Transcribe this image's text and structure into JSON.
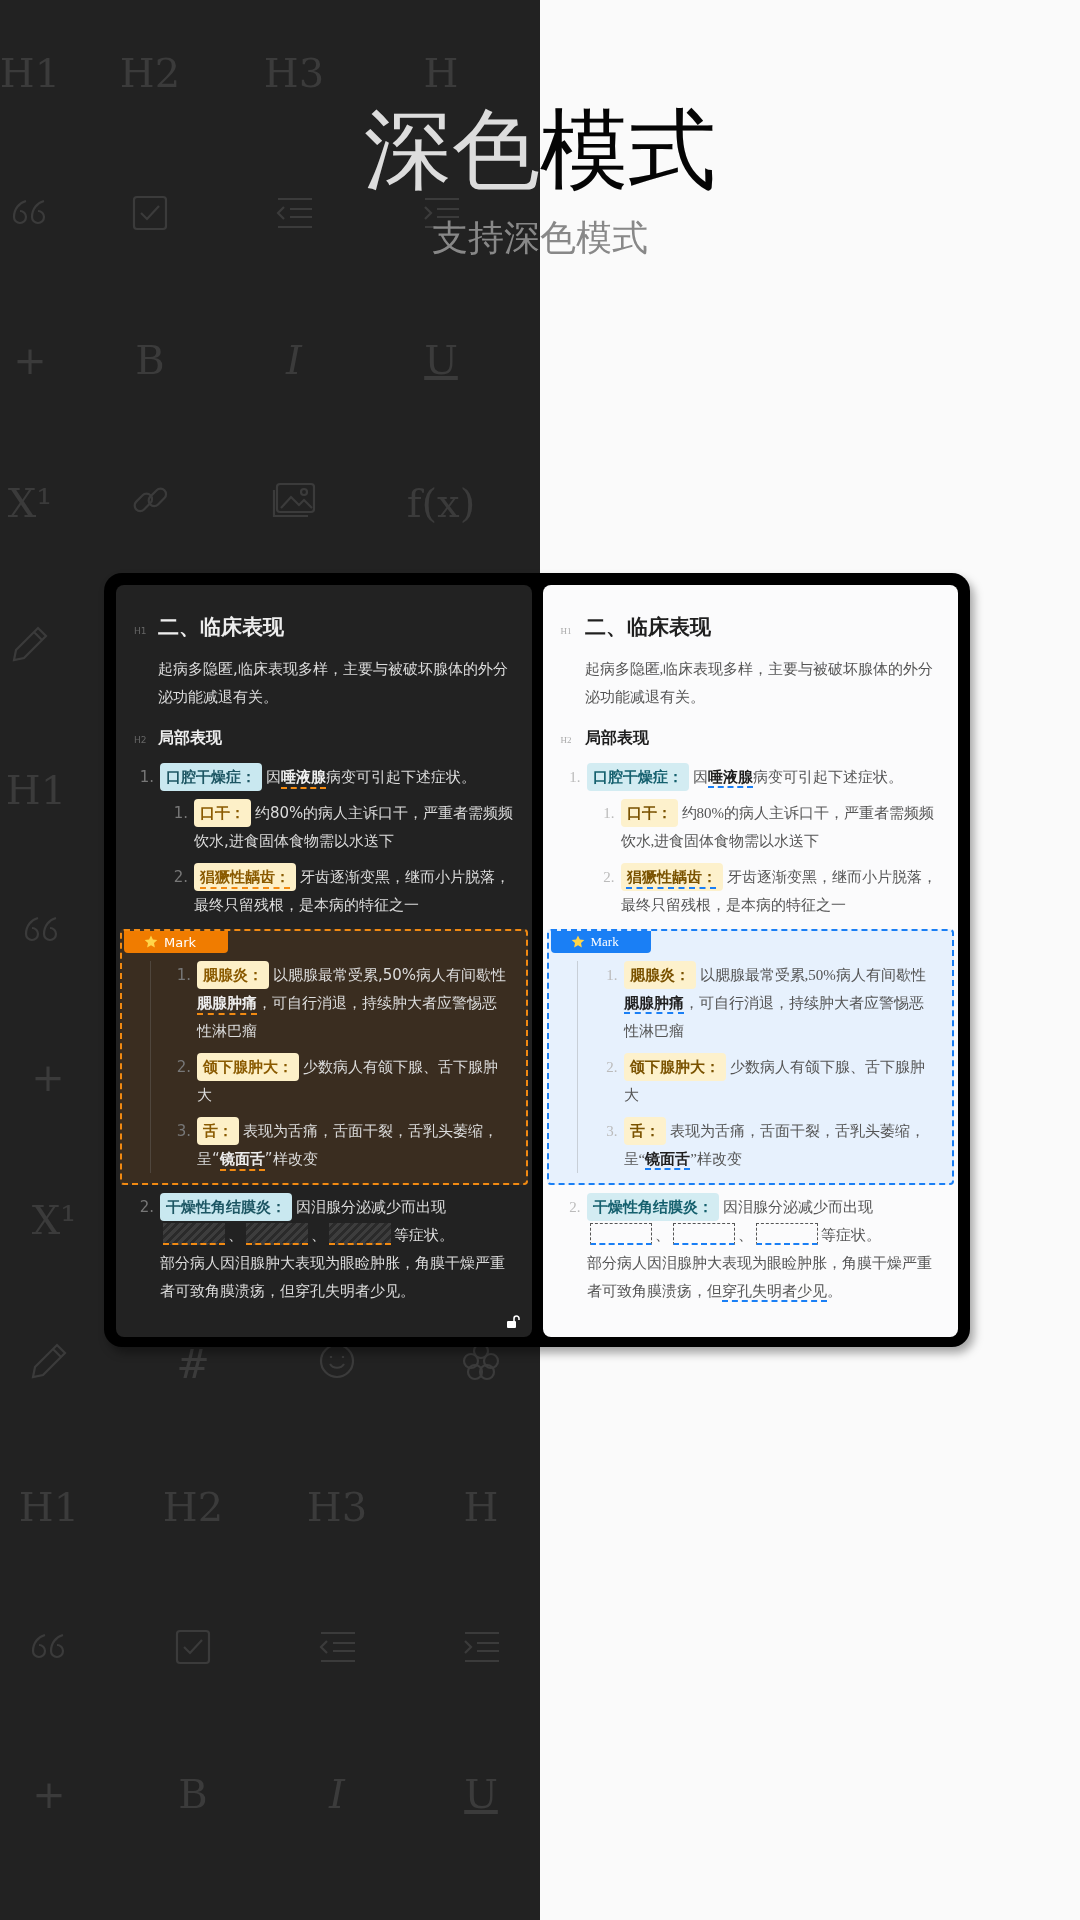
{
  "background_rows": [
    {
      "items": [
        {
          "kind": "text",
          "text": "H1"
        },
        {
          "kind": "text",
          "text": "H2"
        },
        {
          "kind": "text",
          "text": "H3"
        },
        {
          "kind": "text",
          "text": "H"
        }
      ]
    },
    {
      "items": [
        {
          "kind": "quote"
        },
        {
          "kind": "checkbox"
        },
        {
          "kind": "outdent"
        },
        {
          "kind": "indent"
        }
      ]
    },
    {
      "items": [
        {
          "kind": "text",
          "text": "+"
        },
        {
          "kind": "text",
          "text": "B"
        },
        {
          "kind": "text",
          "text": "I",
          "italic": true
        },
        {
          "kind": "text",
          "text": "U",
          "underlined": true
        }
      ]
    },
    {
      "items": [
        {
          "kind": "text",
          "text": "X¹"
        },
        {
          "kind": "link"
        },
        {
          "kind": "image"
        },
        {
          "kind": "text",
          "text": "f(x)"
        }
      ]
    },
    {
      "items": [
        {
          "kind": "pencil"
        }
      ]
    },
    {
      "items": [
        {
          "kind": "text",
          "text": "H1"
        }
      ]
    },
    {
      "items": [
        {
          "kind": "quote"
        }
      ]
    },
    {
      "items": [
        {
          "kind": "text",
          "text": "+"
        }
      ]
    },
    {
      "items": [
        {
          "kind": "text",
          "text": "X¹"
        }
      ]
    },
    {
      "items": [
        {
          "kind": "pencil"
        },
        {
          "kind": "text",
          "text": "#"
        },
        {
          "kind": "smiley"
        },
        {
          "kind": "flower"
        }
      ]
    },
    {
      "items": [
        {
          "kind": "text",
          "text": "H1"
        },
        {
          "kind": "text",
          "text": "H2"
        },
        {
          "kind": "text",
          "text": "H3"
        },
        {
          "kind": "text",
          "text": "H"
        }
      ]
    },
    {
      "items": [
        {
          "kind": "quote"
        },
        {
          "kind": "checkbox"
        },
        {
          "kind": "outdent"
        },
        {
          "kind": "indent"
        }
      ]
    },
    {
      "items": [
        {
          "kind": "text",
          "text": "+"
        },
        {
          "kind": "text",
          "text": "B"
        },
        {
          "kind": "text",
          "text": "I",
          "italic": true
        },
        {
          "kind": "text",
          "text": "U",
          "underlined": true
        }
      ]
    }
  ],
  "title": "深色模式",
  "subtitle": "支持深色模式",
  "panes": [
    {
      "kind": "dark",
      "h1": {
        "marker": "H1",
        "text": "二、临床表现"
      },
      "intro": "起病多隐匿,临床表现多样，主要与被破坏腺体的外分泌功能减退有关。",
      "h2": {
        "marker": "H2",
        "text": "局部表现"
      },
      "blocks": [
        {
          "kind": "item",
          "number": "1.",
          "tag": {
            "text": "口腔干燥症：",
            "color": "#c9e8f0",
            "underlined": false
          },
          "body": [
            {
              "kind": "text",
              "text": "因"
            },
            {
              "kind": "text",
              "text": "唾液腺",
              "bold": true,
              "underlined": true
            },
            {
              "kind": "text",
              "text": "病变可引起下述症状。"
            }
          ],
          "children": [
            {
              "number": "1.",
              "tag": {
                "text": "口干：",
                "color": "#fdf0c8",
                "underlined": false
              },
              "body": [
                {
                  "kind": "text",
                  "text": "约80%的病人主诉口干，严重者需频频饮水,进食固体食物需以水送下"
                }
              ]
            },
            {
              "number": "2.",
              "tag": {
                "text": "猖獗性龋齿：",
                "color": "#fdf0c8",
                "underlined": true
              },
              "body": [
                {
                  "kind": "text",
                  "text": "牙齿逐渐变黑，继而小片脱落，最终只留残根，是本病的特征之一"
                }
              ]
            }
          ]
        },
        {
          "kind": "mark",
          "label": "Mark",
          "children": [
            {
              "number": "1.",
              "tag": {
                "text": "腮腺炎：",
                "color": "#fdf0c8",
                "underlined": false
              },
              "body": [
                {
                  "kind": "text",
                  "text": "以腮腺最常受累,50%病人有间歇性"
                },
                {
                  "kind": "text",
                  "text": "腮腺肿痛",
                  "bold": true,
                  "underlined": true
                },
                {
                  "kind": "text",
                  "text": "，可自行消退，持续肿大者应警惕恶性淋巴瘤"
                }
              ]
            },
            {
              "number": "2.",
              "tag": {
                "text": "颌下腺肿大：",
                "color": "#fdf0c8",
                "underlined": false
              },
              "body": [
                {
                  "kind": "text",
                  "text": "少数病人有颌下腺、舌下腺肿大"
                }
              ]
            },
            {
              "number": "3.",
              "tag": {
                "text": "舌：",
                "color": "#fdf0c8",
                "underlined": false
              },
              "body": [
                {
                  "kind": "text",
                  "text": "表现为舌痛，舌面干裂，舌乳头萎缩，呈“"
                },
                {
                  "kind": "text",
                  "text": "镜面舌",
                  "bold": true,
                  "underlined": true
                },
                {
                  "kind": "text",
                  "text": "”样改变"
                }
              ]
            }
          ]
        },
        {
          "kind": "item",
          "number": "2.",
          "tag": {
            "text": "干燥性角结膜炎：",
            "color": "#c9e8f0",
            "underlined": false
          },
          "body": [
            {
              "kind": "text",
              "text": "因泪腺分泌减少而出现"
            },
            {
              "kind": "blank"
            },
            {
              "kind": "text",
              "text": "、"
            },
            {
              "kind": "blank"
            },
            {
              "kind": "text",
              "text": "、"
            },
            {
              "kind": "blank"
            },
            {
              "kind": "text",
              "text": "等症状。"
            },
            {
              "kind": "line",
              "text": "部分病人因泪腺肿大表现为眼睑肿胀，角膜干燥严重者可致角膜溃疡，但穿孔失明者少见。"
            }
          ]
        }
      ]
    },
    {
      "kind": "light",
      "h1": {
        "marker": "H1",
        "text": "二、临床表现"
      },
      "intro": "起病多隐匿,临床表现多样，主要与被破坏腺体的外分泌功能减退有关。",
      "h2": {
        "marker": "H2",
        "text": "局部表现"
      },
      "blocks": [
        {
          "kind": "item",
          "number": "1.",
          "tag": {
            "text": "口腔干燥症：",
            "color": "#d3ecf2",
            "underlined": false
          },
          "body": [
            {
              "kind": "text",
              "text": "因"
            },
            {
              "kind": "text",
              "text": "唾液腺",
              "bold": true,
              "underlined": true
            },
            {
              "kind": "text",
              "text": "病变可引起下述症状。"
            }
          ],
          "children": [
            {
              "number": "1.",
              "tag": {
                "text": "口干：",
                "color": "#fdf1cc",
                "underlined": false
              },
              "body": [
                {
                  "kind": "text",
                  "text": "约80%的病人主诉口干，严重者需频频饮水,进食固体食物需以水送下"
                }
              ]
            },
            {
              "number": "2.",
              "tag": {
                "text": "猖獗性龋齿：",
                "color": "#fdf1cc",
                "underlined": true
              },
              "body": [
                {
                  "kind": "text",
                  "text": "牙齿逐渐变黑，继而小片脱落，最终只留残根，是本病的特征之一"
                }
              ]
            }
          ]
        },
        {
          "kind": "mark",
          "label": "Mark",
          "children": [
            {
              "number": "1.",
              "tag": {
                "text": "腮腺炎：",
                "color": "#fdf1cc",
                "underlined": false
              },
              "body": [
                {
                  "kind": "text",
                  "text": "以腮腺最常受累,50%病人有间歇性"
                },
                {
                  "kind": "text",
                  "text": "腮腺肿痛",
                  "bold": true,
                  "underlined": true
                },
                {
                  "kind": "text",
                  "text": "，可自行消退，持续肿大者应警惕恶性淋巴瘤"
                }
              ]
            },
            {
              "number": "2.",
              "tag": {
                "text": "颌下腺肿大：",
                "color": "#fdf1cc",
                "underlined": false
              },
              "body": [
                {
                  "kind": "text",
                  "text": "少数病人有颌下腺、舌下腺肿大"
                }
              ]
            },
            {
              "number": "3.",
              "tag": {
                "text": "舌：",
                "color": "#fdf1cc",
                "underlined": false
              },
              "body": [
                {
                  "kind": "text",
                  "text": "表现为舌痛，舌面干裂，舌乳头萎缩，呈“"
                },
                {
                  "kind": "text",
                  "text": "镜面舌",
                  "bold": true,
                  "underlined": true
                },
                {
                  "kind": "text",
                  "text": "”样改变"
                }
              ]
            }
          ]
        },
        {
          "kind": "item",
          "number": "2.",
          "tag": {
            "text": "干燥性角结膜炎：",
            "color": "#d3ecf2",
            "underlined": false
          },
          "body": [
            {
              "kind": "text",
              "text": "因泪腺分泌减少而出现"
            },
            {
              "kind": "blank"
            },
            {
              "kind": "text",
              "text": "、"
            },
            {
              "kind": "blank"
            },
            {
              "kind": "text",
              "text": "、"
            },
            {
              "kind": "blank"
            },
            {
              "kind": "text",
              "text": "等症状。"
            },
            {
              "kind": "line",
              "text": "部分病人因泪腺肿大表现为眼睑肿胀，角膜干燥严重者可致角膜溃疡，但"
            },
            {
              "kind": "line",
              "text": "穿孔失明者少见",
              "underlined": true
            },
            {
              "kind": "line",
              "text": "。"
            }
          ]
        }
      ]
    }
  ]
}
